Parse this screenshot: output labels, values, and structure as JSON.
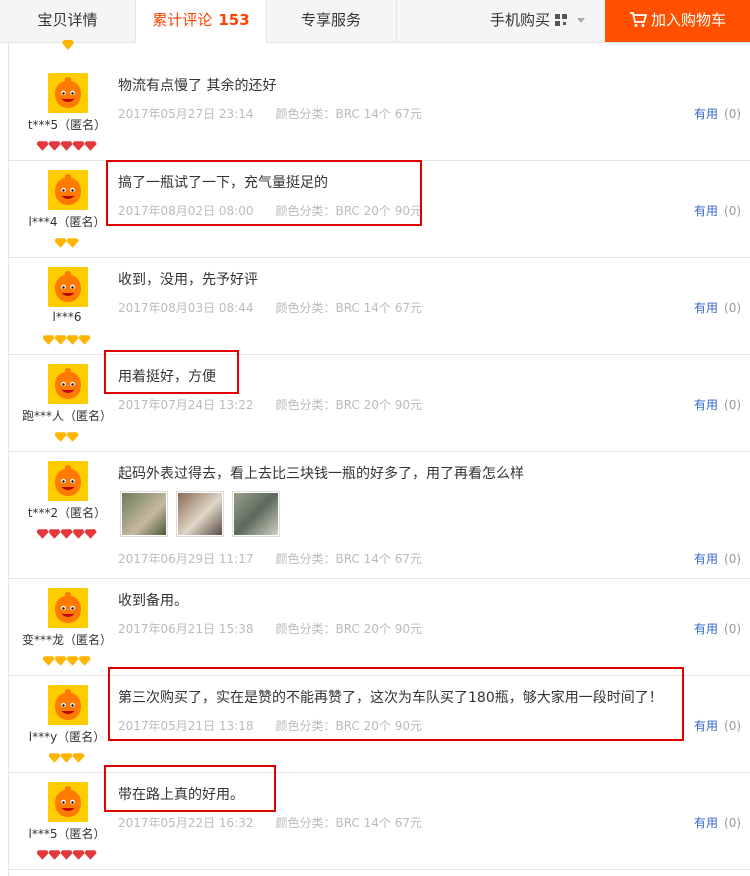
{
  "tabs": [
    {
      "label": "宝贝详情"
    },
    {
      "label": "累计评论",
      "count": "153"
    },
    {
      "label": "专享服务"
    }
  ],
  "mobile_buy": "手机购买",
  "add_to_cart": "加入购物车",
  "useful_label": "有用",
  "spec_prefix": "颜色分类:",
  "colors": {
    "accent": "#ff5000",
    "highlight": "#e00000",
    "link": "#3366cc",
    "avatar": "#ffcc00"
  },
  "reviews": [
    {
      "user": "t***5（匿名）",
      "content": "物流有点慢了 其余的还好",
      "date": "2017年05月27日 23:14",
      "spec": "颜色分类：BRC 14个 67元",
      "useful": "(0)",
      "badge": "red5",
      "highlighted": false
    },
    {
      "user": "l***4（匿名）",
      "content": "搞了一瓶试了一下，充气量挺足的",
      "date": "2017年08月02日 08:00",
      "spec": "颜色分类：BRC 20个 90元",
      "useful": "(0)",
      "badge": "yellow2",
      "highlighted": true
    },
    {
      "user": "l***6",
      "content": "收到，没用，先予好评",
      "date": "2017年08月03日 08:44",
      "spec": "颜色分类：BRC 14个 67元",
      "useful": "(0)",
      "badge": "yellow4",
      "highlighted": false
    },
    {
      "user": "跑***人（匿名）",
      "content": "用着挺好，方便",
      "date": "2017年07月24日 13:22",
      "spec": "颜色分类：BRC 20个 90元",
      "useful": "(0)",
      "badge": "yellow2",
      "highlighted": true
    },
    {
      "user": "t***2（匿名）",
      "content": "起码外表过得去，看上去比三块钱一瓶的好多了，用了再看怎么样",
      "date": "2017年06月29日 11:17",
      "spec": "颜色分类：BRC 14个 67元",
      "useful": "(0)",
      "badge": "red5",
      "highlighted": false,
      "photos": 3
    },
    {
      "user": "变***龙（匿名）",
      "content": "收到备用。",
      "date": "2017年06月21日 15:38",
      "spec": "颜色分类：BRC 20个 90元",
      "useful": "(0)",
      "badge": "yellow4",
      "highlighted": false
    },
    {
      "user": "l***y（匿名）",
      "content": "第三次购买了，实在是赞的不能再赞了，这次为车队买了180瓶，够大家用一段时间了！",
      "date": "2017年05月21日 13:18",
      "spec": "颜色分类：BRC 20个 90元",
      "useful": "(0)",
      "badge": "yellow3",
      "highlighted": true
    },
    {
      "user": "l***5（匿名）",
      "content": "带在路上真的好用。",
      "date": "2017年05月22日 16:32",
      "spec": "颜色分类：BRC 14个 67元",
      "useful": "(0)",
      "badge": "red5",
      "highlighted": true
    }
  ]
}
